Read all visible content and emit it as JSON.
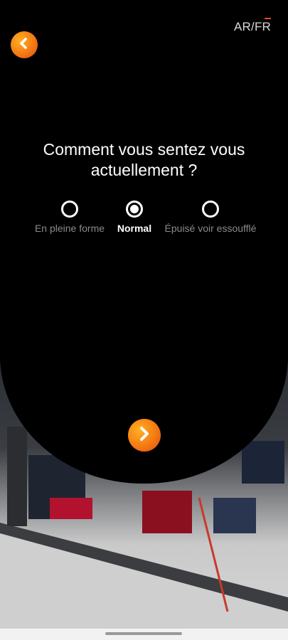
{
  "header": {
    "language_switch": "AR/FR",
    "back_icon": "chevron-left-icon"
  },
  "question": {
    "text": "Comment vous sentez vous actuellement ?"
  },
  "options": [
    {
      "label": "En pleine forme",
      "selected": false
    },
    {
      "label": "Normal",
      "selected": true
    },
    {
      "label": "Épuisé voir essoufflé",
      "selected": false
    }
  ],
  "footer": {
    "next_icon": "chevron-right-icon"
  },
  "colors": {
    "accent_start": "#ffb020",
    "accent_end": "#e24a10",
    "panel": "#000000",
    "unselected_text": "#8a8a8a"
  }
}
